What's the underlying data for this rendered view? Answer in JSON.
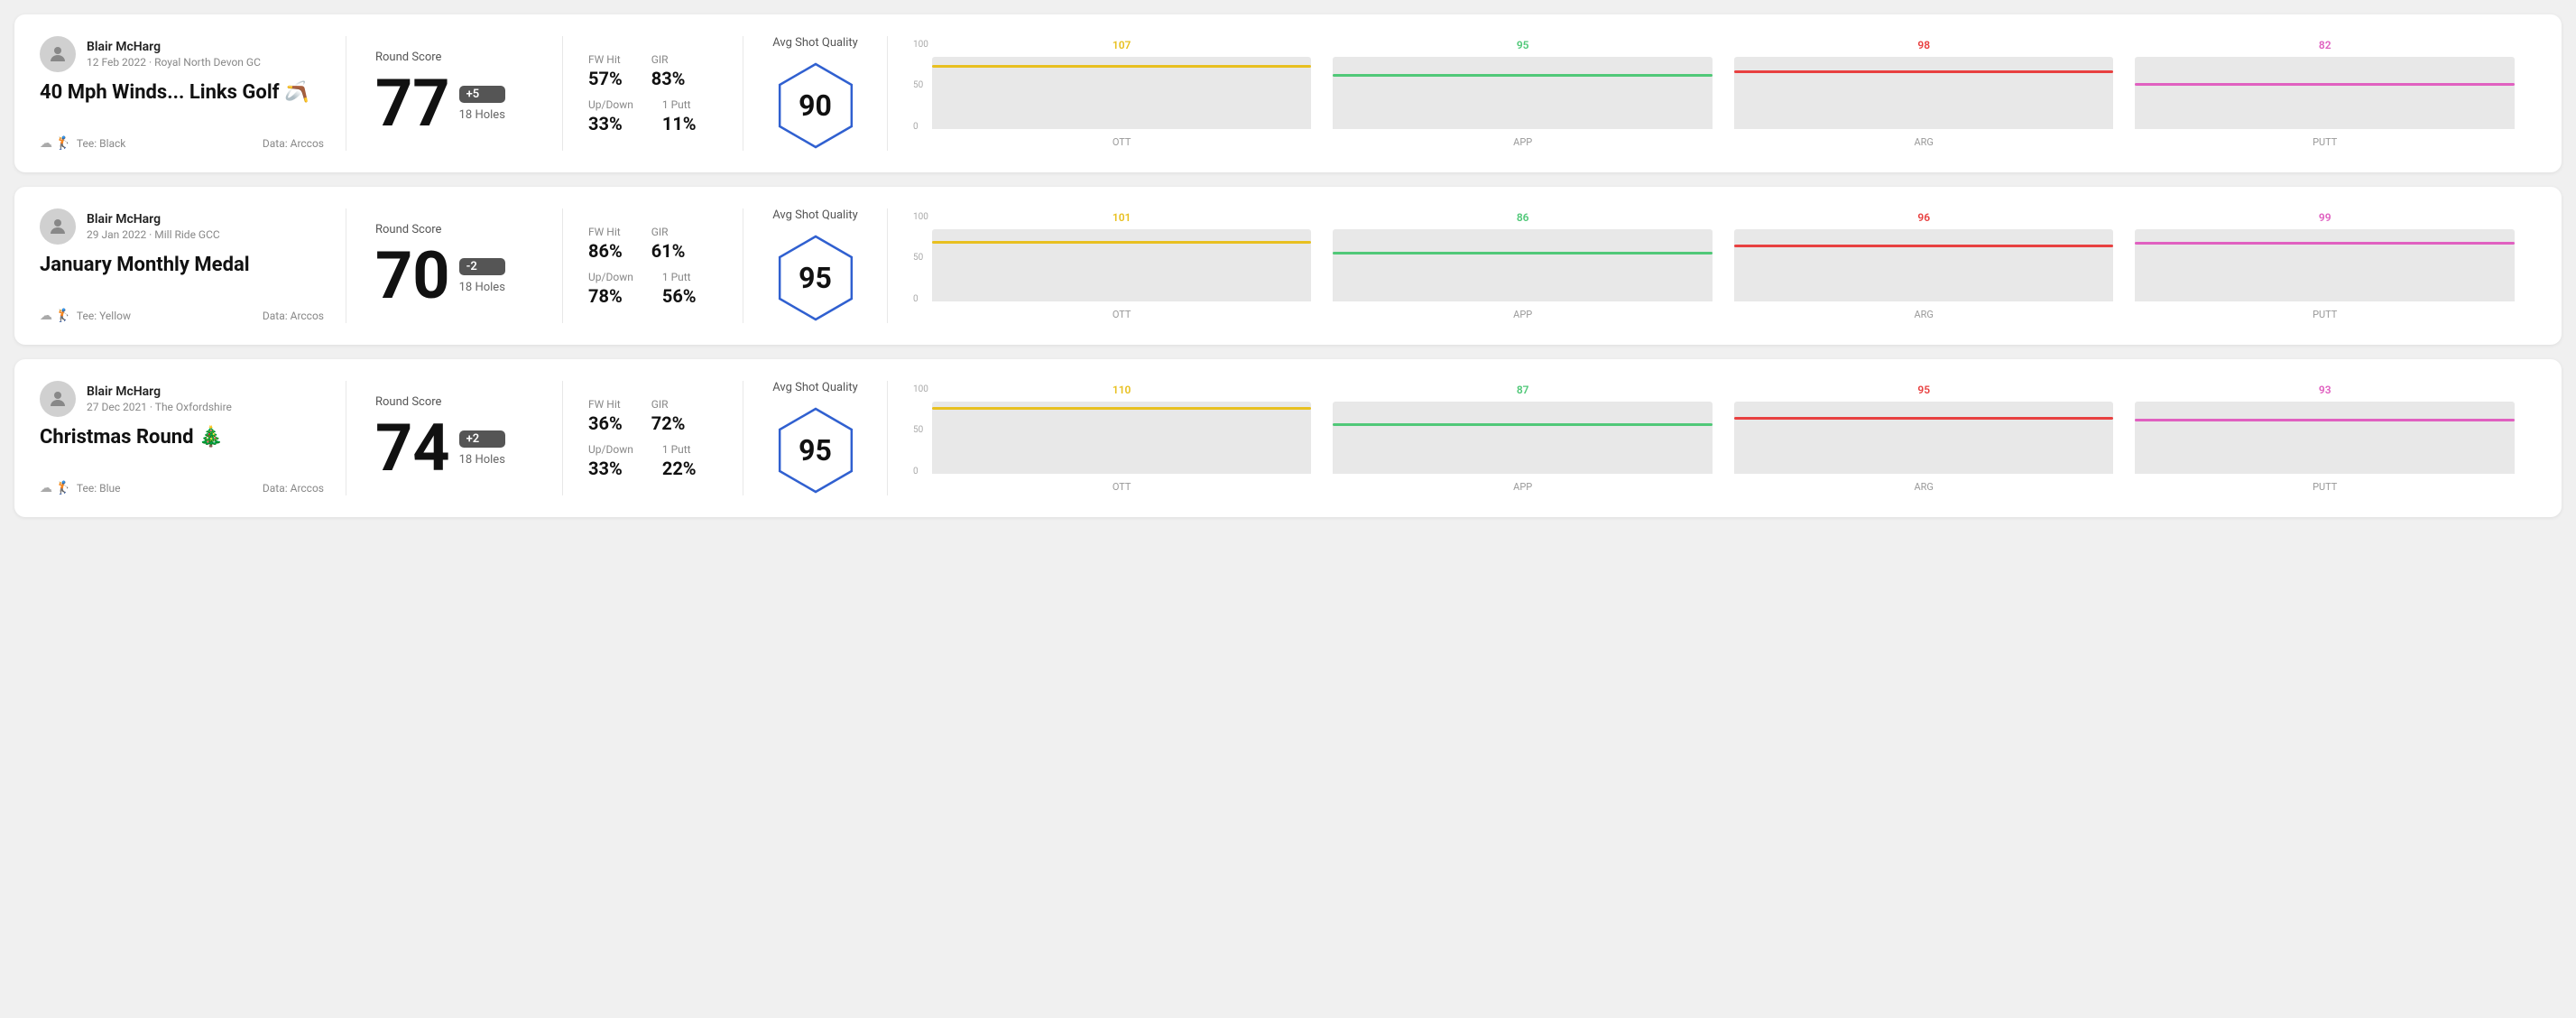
{
  "rounds": [
    {
      "id": "round-1",
      "user": {
        "name": "Blair McHarg",
        "meta": "12 Feb 2022 · Royal North Devon GC"
      },
      "title": "40 Mph Winds... Links Golf 🪃",
      "tee": "Black",
      "data_source": "Data: Arccos",
      "score": "77",
      "score_diff": "+5",
      "holes": "18 Holes",
      "fw_hit": "57%",
      "gir": "83%",
      "up_down": "33%",
      "one_putt": "11%",
      "avg_shot_quality": "90",
      "chart": {
        "ott": {
          "value": 107,
          "color": "#e8c020",
          "bar_pct": 85
        },
        "app": {
          "value": 95,
          "color": "#50c878",
          "bar_pct": 72
        },
        "arg": {
          "value": 98,
          "color": "#e84040",
          "bar_pct": 77
        },
        "putt": {
          "value": 82,
          "color": "#e060c0",
          "bar_pct": 60
        }
      }
    },
    {
      "id": "round-2",
      "user": {
        "name": "Blair McHarg",
        "meta": "29 Jan 2022 · Mill Ride GCC"
      },
      "title": "January Monthly Medal",
      "tee": "Yellow",
      "data_source": "Data: Arccos",
      "score": "70",
      "score_diff": "-2",
      "holes": "18 Holes",
      "fw_hit": "86%",
      "gir": "61%",
      "up_down": "78%",
      "one_putt": "56%",
      "avg_shot_quality": "95",
      "chart": {
        "ott": {
          "value": 101,
          "color": "#e8c020",
          "bar_pct": 80
        },
        "app": {
          "value": 86,
          "color": "#50c878",
          "bar_pct": 65
        },
        "arg": {
          "value": 96,
          "color": "#e84040",
          "bar_pct": 75
        },
        "putt": {
          "value": 99,
          "color": "#e060c0",
          "bar_pct": 78
        }
      }
    },
    {
      "id": "round-3",
      "user": {
        "name": "Blair McHarg",
        "meta": "27 Dec 2021 · The Oxfordshire"
      },
      "title": "Christmas Round 🎄",
      "tee": "Blue",
      "data_source": "Data: Arccos",
      "score": "74",
      "score_diff": "+2",
      "holes": "18 Holes",
      "fw_hit": "36%",
      "gir": "72%",
      "up_down": "33%",
      "one_putt": "22%",
      "avg_shot_quality": "95",
      "chart": {
        "ott": {
          "value": 110,
          "color": "#e8c020",
          "bar_pct": 88
        },
        "app": {
          "value": 87,
          "color": "#50c878",
          "bar_pct": 66
        },
        "arg": {
          "value": 95,
          "color": "#e84040",
          "bar_pct": 74
        },
        "putt": {
          "value": 93,
          "color": "#e060c0",
          "bar_pct": 72
        }
      }
    }
  ],
  "labels": {
    "round_score": "Round Score",
    "fw_hit": "FW Hit",
    "gir": "GIR",
    "up_down": "Up/Down",
    "one_putt": "1 Putt",
    "avg_shot_quality": "Avg Shot Quality",
    "ott": "OTT",
    "app": "APP",
    "arg": "ARG",
    "putt": "PUTT",
    "tee_prefix": "Tee: ",
    "y_100": "100",
    "y_50": "50",
    "y_0": "0"
  }
}
